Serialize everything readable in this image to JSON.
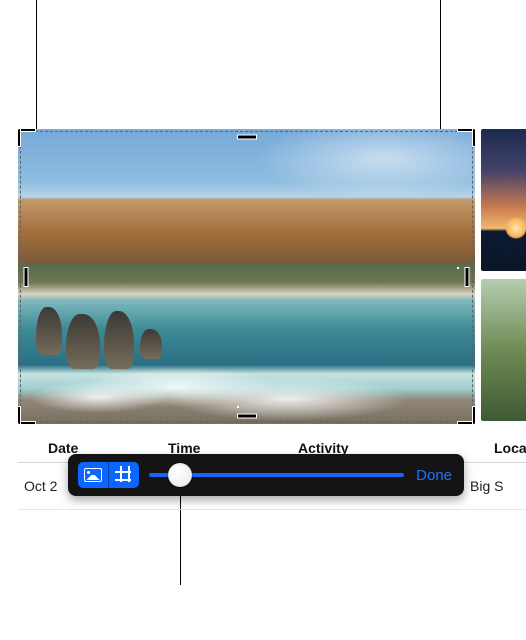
{
  "callouts": {
    "top_left_pointer": true,
    "top_right_pointer": true,
    "bottom_pointer": true
  },
  "crop": {
    "active": true
  },
  "table": {
    "headers": {
      "date": "Date",
      "time": "Time",
      "activity": "Activity",
      "location": "Locat"
    },
    "row": {
      "date": "Oct 2",
      "time": "",
      "activity": "",
      "location": "Big S"
    }
  },
  "toolbar": {
    "mode_photo_selected": false,
    "mode_crop_selected": true,
    "slider_position_percent": 12,
    "done_label": "Done"
  },
  "icons": {
    "photo": "photo-icon",
    "crop": "crop-icon"
  },
  "colors": {
    "accent": "#1a74ff",
    "toolbar_bg": "#141414"
  }
}
